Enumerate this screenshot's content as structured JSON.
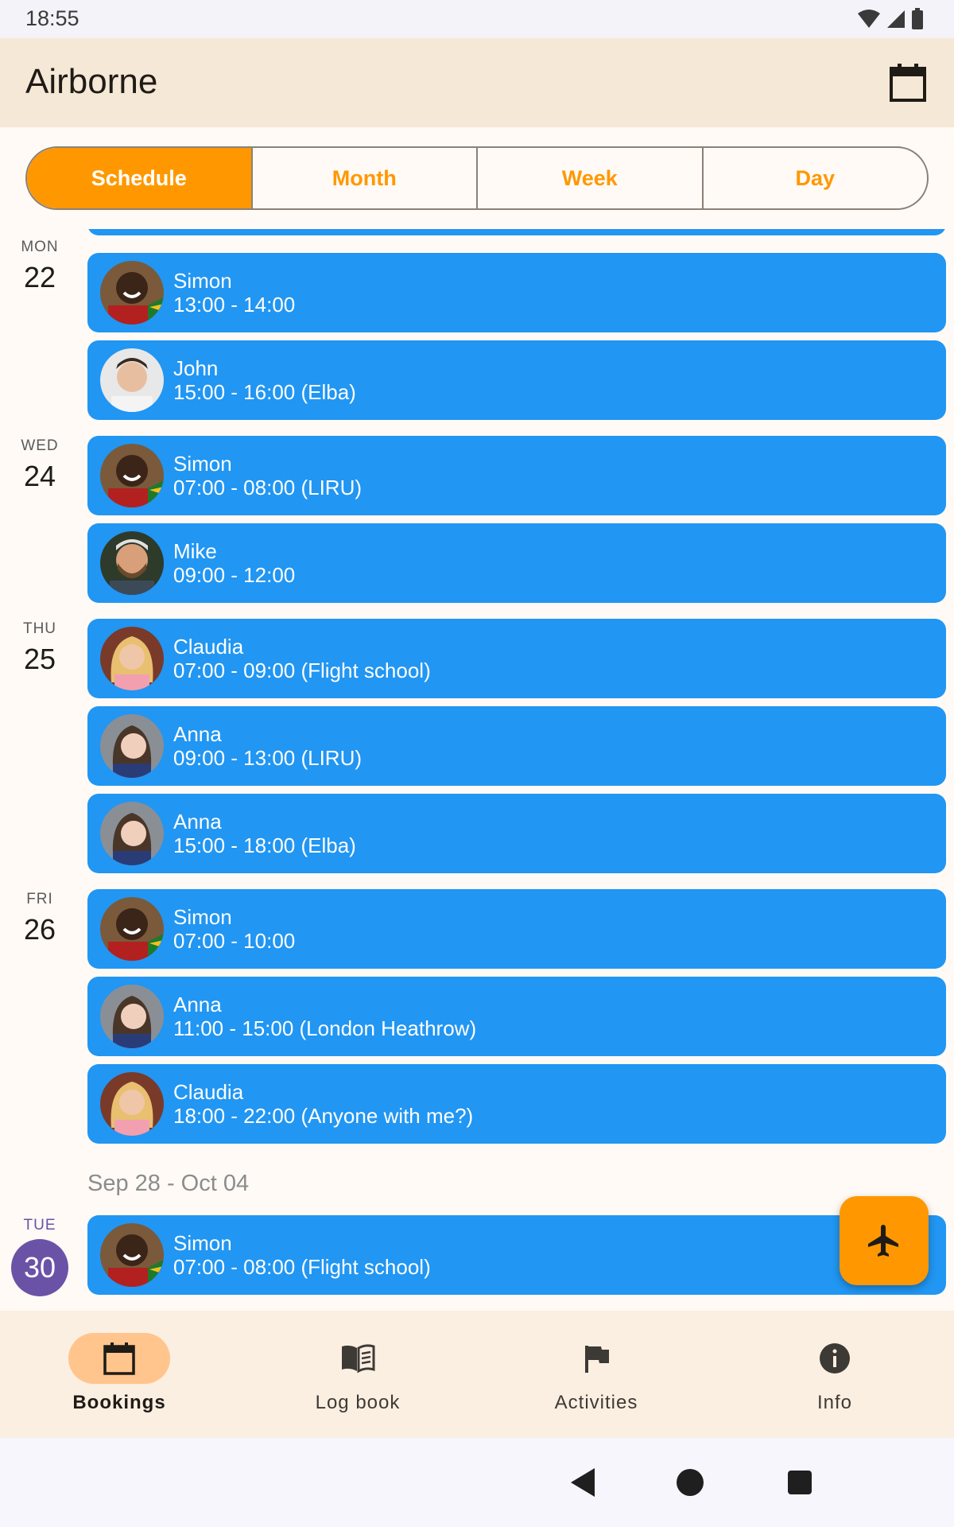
{
  "status": {
    "time": "18:55",
    "icons": [
      "wifi-icon",
      "signal-icon",
      "battery-icon"
    ]
  },
  "app": {
    "title": "Airborne",
    "action_icon": "calendar-icon"
  },
  "view_tabs": [
    {
      "label": "Schedule",
      "active": true
    },
    {
      "label": "Month",
      "active": false
    },
    {
      "label": "Week",
      "active": false
    },
    {
      "label": "Day",
      "active": false
    }
  ],
  "days": [
    {
      "dow": "MON",
      "num": "22"
    },
    {
      "dow": "WED",
      "num": "24"
    },
    {
      "dow": "THU",
      "num": "25"
    },
    {
      "dow": "FRI",
      "num": "26"
    },
    {
      "dow": "TUE",
      "num": "30",
      "today": true
    }
  ],
  "bookings": [
    {
      "name": "Simon",
      "time": "13:00 - 14:00"
    },
    {
      "name": "John",
      "time": "15:00 - 16:00 (Elba)"
    },
    {
      "name": "Simon",
      "time": "07:00 - 08:00 (LIRU)"
    },
    {
      "name": "Mike",
      "time": "09:00 - 12:00"
    },
    {
      "name": "Claudia",
      "time": "07:00 - 09:00 (Flight school)"
    },
    {
      "name": "Anna",
      "time": "09:00 - 13:00 (LIRU)"
    },
    {
      "name": "Anna",
      "time": "15:00 - 18:00 (Elba)"
    },
    {
      "name": "Simon",
      "time": "07:00 - 10:00"
    },
    {
      "name": "Anna",
      "time": "11:00 - 15:00 (London Heathrow)"
    },
    {
      "name": "Claudia",
      "time": "18:00 - 22:00 (Anyone with me?)"
    },
    {
      "name": "Simon",
      "time": "07:00 - 08:00 (Flight school)"
    }
  ],
  "week_header": "Sep 28 - Oct 04",
  "fab_icon": "airplane-icon",
  "bottom_nav": [
    {
      "label": "Bookings",
      "icon": "calendar-icon",
      "active": true
    },
    {
      "label": "Log book",
      "icon": "book-icon",
      "active": false
    },
    {
      "label": "Activities",
      "icon": "flag-icon",
      "active": false
    },
    {
      "label": "Info",
      "icon": "info-icon",
      "active": false
    }
  ],
  "colors": {
    "accent": "#ff9800",
    "card": "#2196f3",
    "today": "#6a52a7",
    "app_bar": "#f6e8d6"
  }
}
